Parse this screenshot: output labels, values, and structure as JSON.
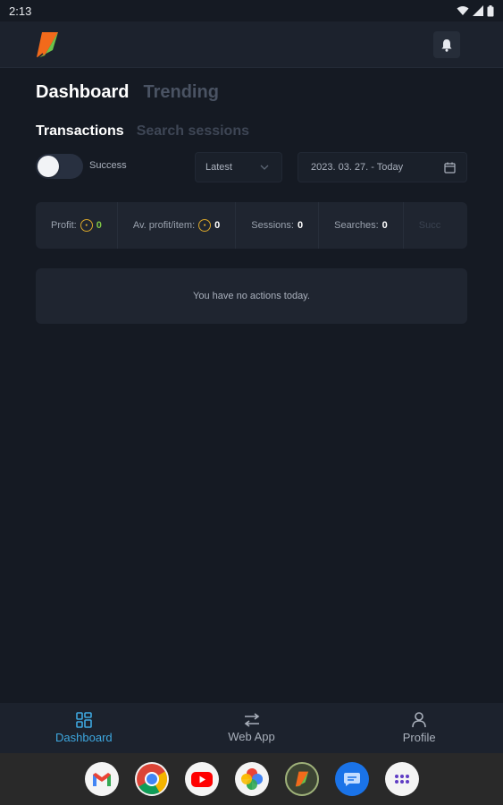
{
  "status_bar": {
    "time": "2:13"
  },
  "header": {
    "logo": "app-logo",
    "bell_icon": "bell-icon"
  },
  "main_tabs": [
    {
      "label": "Dashboard",
      "active": true
    },
    {
      "label": "Trending",
      "active": false
    }
  ],
  "sub_tabs": [
    {
      "label": "Transactions",
      "active": true
    },
    {
      "label": "Search sessions",
      "active": false
    }
  ],
  "filters": {
    "toggle_label": "Success",
    "toggle_on": false,
    "sort_value": "Latest",
    "date_range": "2023. 03. 27. - Today"
  },
  "stats": {
    "profit_label": "Profit:",
    "profit_value": "0",
    "avg_label": "Av. profit/item:",
    "avg_value": "0",
    "sessions_label": "Sessions:",
    "sessions_value": "0",
    "searches_label": "Searches:",
    "searches_value": "0",
    "success_label": "Succ"
  },
  "empty_message": "You have no actions today.",
  "bottom_nav": [
    {
      "label": "Dashboard",
      "icon": "grid-icon",
      "active": true
    },
    {
      "label": "Web App",
      "icon": "arrows-swap-icon",
      "active": false
    },
    {
      "label": "Profile",
      "icon": "person-icon",
      "active": false
    }
  ],
  "dock_apps": [
    "gmail-icon",
    "chrome-icon",
    "youtube-icon",
    "photos-icon",
    "app-logo",
    "messages-icon",
    "app-drawer-icon"
  ],
  "colors": {
    "background": "#151a23",
    "card": "#1f2530",
    "accent": "#3ea8e0",
    "profit_green": "#7ec545",
    "coin_gold": "#d9a62a"
  }
}
